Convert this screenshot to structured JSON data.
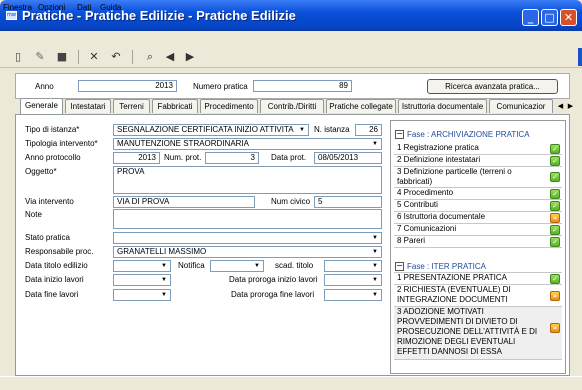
{
  "window": {
    "title": "Pratiche - Pratiche Edilizie - Pratiche Edilizie",
    "app_icon": "mw"
  },
  "menu": [
    "Finestra",
    "Opzioni",
    "Dati",
    "Guida"
  ],
  "toolbar": {
    "icons": [
      "new-document-icon",
      "edit-document-icon",
      "save-icon",
      "delete-icon",
      "undo-icon",
      "search-icon",
      "back-arrow-icon",
      "forward-arrow-icon"
    ]
  },
  "header": {
    "anno_label": "Anno",
    "anno_value": "2013",
    "numero_label": "Numero pratica",
    "numero_value": "89",
    "ricerca_button": "Ricerca avanzata pratica..."
  },
  "tabs": [
    "Generale",
    "Intestatari",
    "Terreni",
    "Fabbricati",
    "Procedimento",
    "Contrib./Diritti",
    "Pratiche collegate",
    "Istruttoria documentale",
    "Comunicazior"
  ],
  "form": {
    "tipo_istanza_label": "Tipo di istanza*",
    "tipo_istanza_value": "SEGNALAZIONE CERTIFICATA INIZIO ATTIVITA",
    "n_istanza_label": "N. istanza",
    "n_istanza_value": "26",
    "tipologia_label": "Tipologia intervento*",
    "tipologia_value": "MANUTENZIONE STRAORDINARIA",
    "anno_prot_label": "Anno protocollo",
    "anno_prot_value": "2013",
    "num_prot_label": "Num. prot.",
    "num_prot_value": "3",
    "data_prot_label": "Data prot.",
    "data_prot_value": "08/05/2013",
    "oggetto_label": "Oggetto*",
    "oggetto_value": "PROVA",
    "via_label": "Via intervento",
    "via_value": "VIA DI PROVA",
    "civico_label": "Num civico",
    "civico_value": "5",
    "note_label": "Note",
    "note_value": "",
    "stato_label": "Stato pratica",
    "stato_value": "",
    "responsabile_label": "Responsabile proc.",
    "responsabile_value": "GRANATELLI MASSIMO",
    "data_titolo_label": "Data titolo edilizio",
    "notifica_label": "Notifica",
    "scad_titolo_label": "scad. titolo",
    "data_inizio_label": "Data inizio lavori",
    "proroga_inizio_label": "Data proroga inizio lavori",
    "data_fine_label": "Data fine lavori",
    "proroga_fine_label": "Data proroga fine lavori"
  },
  "phases": {
    "archiviazione": {
      "title": "Fase : ARCHIVIAZIONE PRATICA",
      "items": [
        {
          "label": "1 Registrazione pratica",
          "status": "ok"
        },
        {
          "label": "2 Definizione intestatari",
          "status": "ok"
        },
        {
          "label": "3 Definizione particelle (terreni o fabbricati)",
          "status": "ok"
        },
        {
          "label": "4 Procedimento",
          "status": "ok"
        },
        {
          "label": "5 Contributi",
          "status": "ok"
        },
        {
          "label": "6 Istruttoria documentale",
          "status": "warn"
        },
        {
          "label": "7 Comunicazioni",
          "status": "ok"
        },
        {
          "label": "8 Pareri",
          "status": "ok"
        }
      ]
    },
    "iter": {
      "title": "Fase : ITER PRATICA",
      "items": [
        {
          "label": "1 PRESENTAZIONE PRATICA",
          "status": "ok"
        },
        {
          "label": "2 RICHIESTA (EVENTUALE) DI INTEGRAZIONE DOCUMENTI",
          "status": "warn"
        },
        {
          "label": "3 ADOZIONE MOTIVATI PROVVEDIMENTI DI DIVIETO DI PROSECUZIONE DELL'ATTIVITÀ E DI RIMOZIONE DEGLI EVENTUALI EFFETTI DANNOSI DI ESSA",
          "status": "warn"
        }
      ]
    }
  },
  "colors": {
    "titlebar": "#0a50d8",
    "ok": "#57b32a",
    "warn": "#f08a1a",
    "phase_text": "#1f4b9a"
  }
}
